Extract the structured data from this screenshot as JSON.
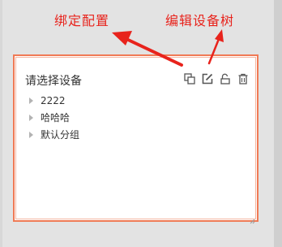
{
  "annotations": {
    "bind_config": "绑定配置",
    "edit_device_tree": "编辑设备树"
  },
  "panel": {
    "title": "请选择设备",
    "toolbar": [
      {
        "icon": "copy-icon",
        "label": "绑定配置"
      },
      {
        "icon": "edit-icon",
        "label": "编辑设备树"
      },
      {
        "icon": "unlock-icon",
        "label": ""
      },
      {
        "icon": "trash-icon",
        "label": ""
      }
    ],
    "tree_items": [
      {
        "label": "2222"
      },
      {
        "label": "哈哈哈"
      },
      {
        "label": "默认分组"
      }
    ]
  },
  "colors": {
    "annotation": "#e8231c",
    "border": "#f07a55",
    "icon": "#555555"
  }
}
